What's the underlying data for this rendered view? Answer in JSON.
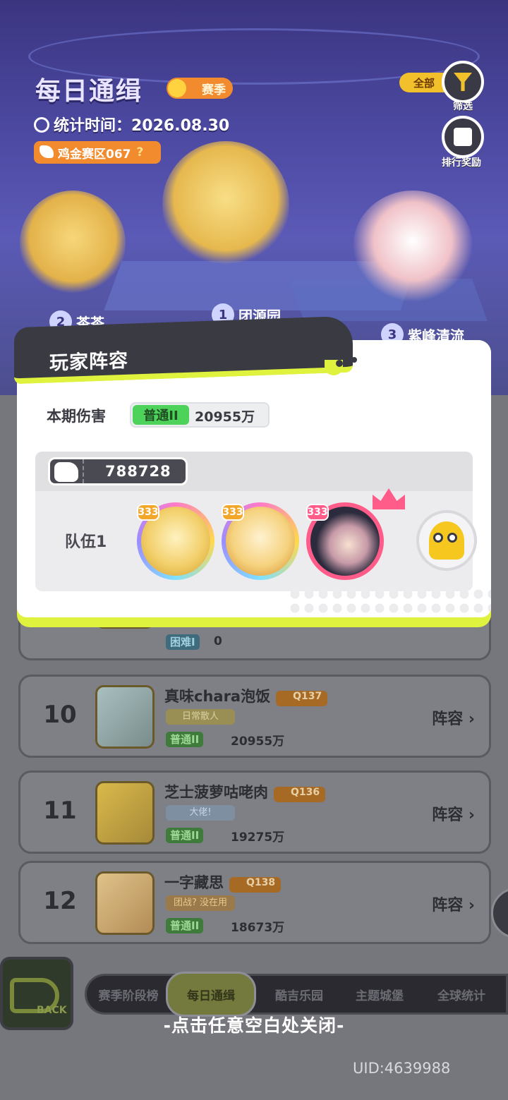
{
  "header": {
    "title": "每日通缉",
    "season_badge": "赛季",
    "stat_time_label": "统计时间：2026.08.30",
    "region": "鸡金赛区067",
    "region_help": "?",
    "filter_pill": "全部",
    "filter_button_label": "筛选",
    "rank_reward_label": "排行奖励"
  },
  "podium": [
    {
      "rank": "2",
      "name": "茶茶"
    },
    {
      "rank": "1",
      "name": "团源园"
    },
    {
      "rank": "3",
      "name": "紫峰清流"
    }
  ],
  "modal": {
    "title": "玩家阵容",
    "damage_label": "本期伤害",
    "damage_mode": "普通II",
    "damage_value": "20955万",
    "power": "788728",
    "team_label": "队伍1",
    "heroes": [
      {
        "level": "333",
        "name": "hero-1"
      },
      {
        "level": "333",
        "name": "hero-2"
      },
      {
        "level": "333",
        "name": "hero-3"
      }
    ],
    "pet_icon": "yellow-jellyfish-pet"
  },
  "list": {
    "partial_row": {
      "mode": "困难I",
      "damage": "0"
    },
    "rows": [
      {
        "rank": "10",
        "name": "真味chara泡饭",
        "level": "Q137",
        "title_tag": "日常散人",
        "mode": "普通II",
        "damage": "20955万",
        "lineup": "阵容"
      },
      {
        "rank": "11",
        "name": "芝士菠萝咕咾肉",
        "level": "Q136",
        "title_tag": "大佬!",
        "mode": "普通II",
        "damage": "19275万",
        "lineup": "阵容"
      },
      {
        "rank": "12",
        "name": "一字藏思",
        "level": "Q138",
        "title_tag": "团战? 没在用",
        "mode": "普通II",
        "damage": "18673万",
        "lineup": "阵容"
      }
    ]
  },
  "back_label": "BACK",
  "nav_tabs": [
    "赛季阶段榜",
    "每日通缉",
    "酷吉乐园",
    "主题城堡",
    "全球统计"
  ],
  "nav_active": "每日通缉",
  "close_hint": "-点击任意空白处关闭-",
  "uid": "UID:4639988",
  "colors": {
    "accent_lime": "#dff23d",
    "mode_green": "#4dd35a",
    "orange": "#f18b2d",
    "dark": "#3a3a42"
  }
}
